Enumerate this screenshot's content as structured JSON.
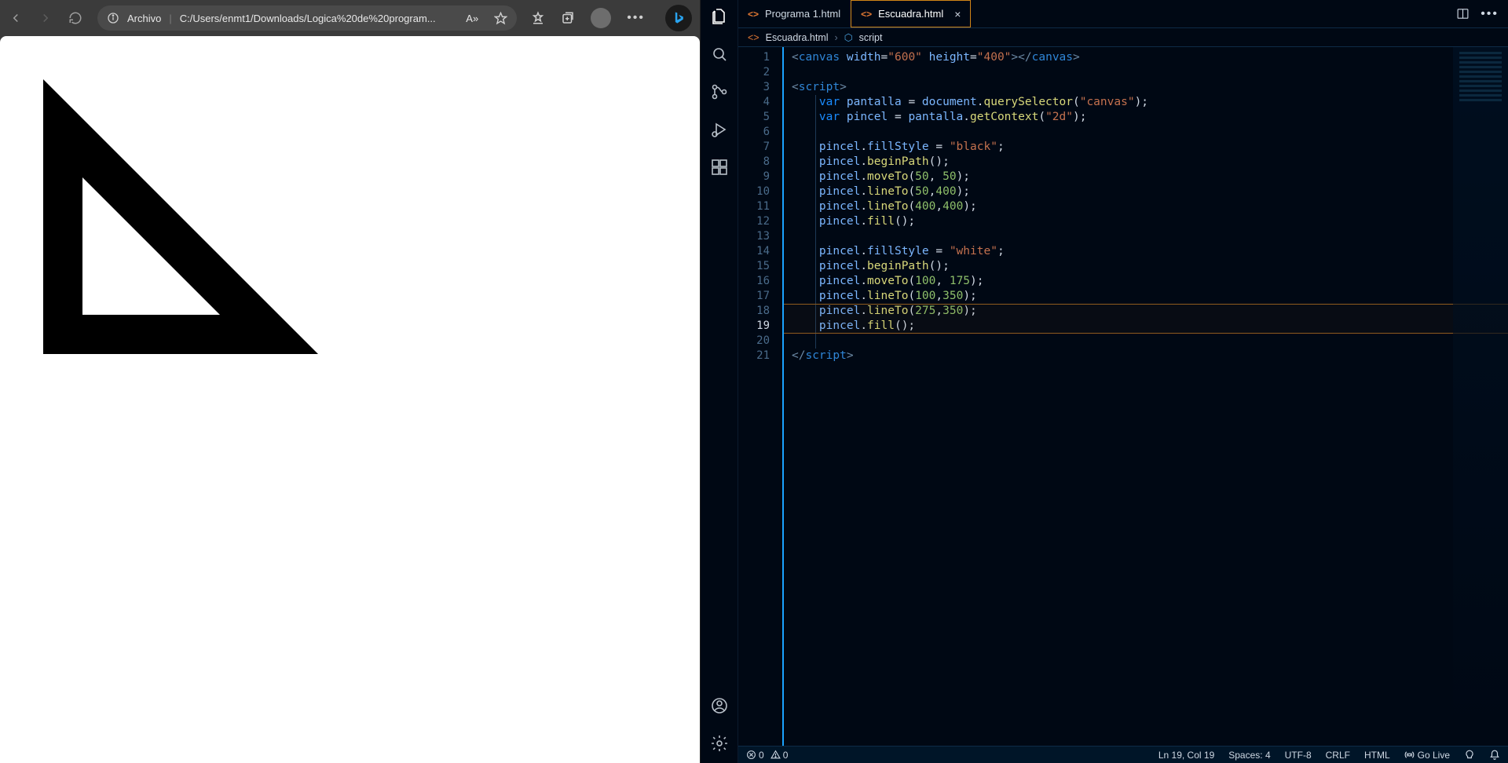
{
  "browser": {
    "archivo_label": "Archivo",
    "url": "C:/Users/enmt1/Downloads/Logica%20de%20program...",
    "favorites_badge": "A»"
  },
  "vscode": {
    "tabs": [
      {
        "icon": "<>",
        "label": "Programa 1.html",
        "active": false
      },
      {
        "icon": "<>",
        "label": "Escuadra.html",
        "active": true
      }
    ],
    "breadcrumb": {
      "file_icon": "<>",
      "file": "Escuadra.html",
      "segment_icon": "⬡",
      "segment": "script"
    },
    "gutter": [
      "1",
      "2",
      "3",
      "4",
      "5",
      "6",
      "7",
      "8",
      "9",
      "10",
      "11",
      "12",
      "13",
      "14",
      "15",
      "16",
      "17",
      "18",
      "19",
      "20",
      "21"
    ],
    "current_line": "19",
    "status": {
      "errors": "0",
      "warnings": "0",
      "position": "Ln 19, Col 19",
      "spaces": "Spaces: 4",
      "encoding": "UTF-8",
      "eol": "CRLF",
      "lang": "HTML",
      "golive": "Go Live"
    },
    "code_tokens": [
      [
        {
          "c": "tk-pun",
          "t": "<"
        },
        {
          "c": "tk-tag",
          "t": "canvas"
        },
        {
          "c": "",
          "t": " "
        },
        {
          "c": "tk-attr",
          "t": "width"
        },
        {
          "c": "tk-op",
          "t": "="
        },
        {
          "c": "tk-str",
          "t": "\"600\""
        },
        {
          "c": "",
          "t": " "
        },
        {
          "c": "tk-attr",
          "t": "height"
        },
        {
          "c": "tk-op",
          "t": "="
        },
        {
          "c": "tk-str",
          "t": "\"400\""
        },
        {
          "c": "tk-pun",
          "t": "></"
        },
        {
          "c": "tk-tag",
          "t": "canvas"
        },
        {
          "c": "tk-pun",
          "t": ">"
        }
      ],
      [],
      [
        {
          "c": "tk-pun",
          "t": "<"
        },
        {
          "c": "tk-tag",
          "t": "script"
        },
        {
          "c": "tk-pun",
          "t": ">"
        }
      ],
      [
        {
          "c": "",
          "t": "    "
        },
        {
          "c": "tk-kw",
          "t": "var"
        },
        {
          "c": "",
          "t": " "
        },
        {
          "c": "tk-var",
          "t": "pantalla"
        },
        {
          "c": "",
          "t": " "
        },
        {
          "c": "tk-op",
          "t": "="
        },
        {
          "c": "",
          "t": " "
        },
        {
          "c": "tk-var",
          "t": "document"
        },
        {
          "c": "tk-op",
          "t": "."
        },
        {
          "c": "tk-fn",
          "t": "querySelector"
        },
        {
          "c": "tk-op",
          "t": "("
        },
        {
          "c": "tk-str",
          "t": "\"canvas\""
        },
        {
          "c": "tk-op",
          "t": ");"
        }
      ],
      [
        {
          "c": "",
          "t": "    "
        },
        {
          "c": "tk-kw",
          "t": "var"
        },
        {
          "c": "",
          "t": " "
        },
        {
          "c": "tk-var",
          "t": "pincel"
        },
        {
          "c": "",
          "t": " "
        },
        {
          "c": "tk-op",
          "t": "="
        },
        {
          "c": "",
          "t": " "
        },
        {
          "c": "tk-var",
          "t": "pantalla"
        },
        {
          "c": "tk-op",
          "t": "."
        },
        {
          "c": "tk-fn",
          "t": "getContext"
        },
        {
          "c": "tk-op",
          "t": "("
        },
        {
          "c": "tk-str",
          "t": "\"2d\""
        },
        {
          "c": "tk-op",
          "t": ");"
        }
      ],
      [],
      [
        {
          "c": "",
          "t": "    "
        },
        {
          "c": "tk-var",
          "t": "pincel"
        },
        {
          "c": "tk-op",
          "t": "."
        },
        {
          "c": "tk-prop",
          "t": "fillStyle"
        },
        {
          "c": "",
          "t": " "
        },
        {
          "c": "tk-op",
          "t": "="
        },
        {
          "c": "",
          "t": " "
        },
        {
          "c": "tk-str",
          "t": "\"black\""
        },
        {
          "c": "tk-op",
          "t": ";"
        }
      ],
      [
        {
          "c": "",
          "t": "    "
        },
        {
          "c": "tk-var",
          "t": "pincel"
        },
        {
          "c": "tk-op",
          "t": "."
        },
        {
          "c": "tk-fn",
          "t": "beginPath"
        },
        {
          "c": "tk-op",
          "t": "();"
        }
      ],
      [
        {
          "c": "",
          "t": "    "
        },
        {
          "c": "tk-var",
          "t": "pincel"
        },
        {
          "c": "tk-op",
          "t": "."
        },
        {
          "c": "tk-fn",
          "t": "moveTo"
        },
        {
          "c": "tk-op",
          "t": "("
        },
        {
          "c": "tk-num",
          "t": "50"
        },
        {
          "c": "tk-op",
          "t": ", "
        },
        {
          "c": "tk-num",
          "t": "50"
        },
        {
          "c": "tk-op",
          "t": ");"
        }
      ],
      [
        {
          "c": "",
          "t": "    "
        },
        {
          "c": "tk-var",
          "t": "pincel"
        },
        {
          "c": "tk-op",
          "t": "."
        },
        {
          "c": "tk-fn",
          "t": "lineTo"
        },
        {
          "c": "tk-op",
          "t": "("
        },
        {
          "c": "tk-num",
          "t": "50"
        },
        {
          "c": "tk-op",
          "t": ","
        },
        {
          "c": "tk-num",
          "t": "400"
        },
        {
          "c": "tk-op",
          "t": ");"
        }
      ],
      [
        {
          "c": "",
          "t": "    "
        },
        {
          "c": "tk-var",
          "t": "pincel"
        },
        {
          "c": "tk-op",
          "t": "."
        },
        {
          "c": "tk-fn",
          "t": "lineTo"
        },
        {
          "c": "tk-op",
          "t": "("
        },
        {
          "c": "tk-num",
          "t": "400"
        },
        {
          "c": "tk-op",
          "t": ","
        },
        {
          "c": "tk-num",
          "t": "400"
        },
        {
          "c": "tk-op",
          "t": ");"
        }
      ],
      [
        {
          "c": "",
          "t": "    "
        },
        {
          "c": "tk-var",
          "t": "pincel"
        },
        {
          "c": "tk-op",
          "t": "."
        },
        {
          "c": "tk-fn",
          "t": "fill"
        },
        {
          "c": "tk-op",
          "t": "();"
        }
      ],
      [],
      [
        {
          "c": "",
          "t": "    "
        },
        {
          "c": "tk-var",
          "t": "pincel"
        },
        {
          "c": "tk-op",
          "t": "."
        },
        {
          "c": "tk-prop",
          "t": "fillStyle"
        },
        {
          "c": "",
          "t": " "
        },
        {
          "c": "tk-op",
          "t": "="
        },
        {
          "c": "",
          "t": " "
        },
        {
          "c": "tk-str",
          "t": "\"white\""
        },
        {
          "c": "tk-op",
          "t": ";"
        }
      ],
      [
        {
          "c": "",
          "t": "    "
        },
        {
          "c": "tk-var",
          "t": "pincel"
        },
        {
          "c": "tk-op",
          "t": "."
        },
        {
          "c": "tk-fn",
          "t": "beginPath"
        },
        {
          "c": "tk-op",
          "t": "();"
        }
      ],
      [
        {
          "c": "",
          "t": "    "
        },
        {
          "c": "tk-var",
          "t": "pincel"
        },
        {
          "c": "tk-op",
          "t": "."
        },
        {
          "c": "tk-fn",
          "t": "moveTo"
        },
        {
          "c": "tk-op",
          "t": "("
        },
        {
          "c": "tk-num",
          "t": "100"
        },
        {
          "c": "tk-op",
          "t": ", "
        },
        {
          "c": "tk-num",
          "t": "175"
        },
        {
          "c": "tk-op",
          "t": ");"
        }
      ],
      [
        {
          "c": "",
          "t": "    "
        },
        {
          "c": "tk-var",
          "t": "pincel"
        },
        {
          "c": "tk-op",
          "t": "."
        },
        {
          "c": "tk-fn",
          "t": "lineTo"
        },
        {
          "c": "tk-op",
          "t": "("
        },
        {
          "c": "tk-num",
          "t": "100"
        },
        {
          "c": "tk-op",
          "t": ","
        },
        {
          "c": "tk-num",
          "t": "350"
        },
        {
          "c": "tk-op",
          "t": ");"
        }
      ],
      [
        {
          "c": "",
          "t": "    "
        },
        {
          "c": "tk-var",
          "t": "pincel"
        },
        {
          "c": "tk-op",
          "t": "."
        },
        {
          "c": "tk-fn",
          "t": "lineTo"
        },
        {
          "c": "tk-op",
          "t": "("
        },
        {
          "c": "tk-num",
          "t": "275"
        },
        {
          "c": "tk-op",
          "t": ","
        },
        {
          "c": "tk-num",
          "t": "350"
        },
        {
          "c": "tk-op",
          "t": ");"
        }
      ],
      [
        {
          "c": "",
          "t": "    "
        },
        {
          "c": "tk-var",
          "t": "pincel"
        },
        {
          "c": "tk-op",
          "t": "."
        },
        {
          "c": "tk-fn",
          "t": "fill"
        },
        {
          "c": "tk-op",
          "t": "();"
        }
      ],
      [],
      [
        {
          "c": "tk-pun",
          "t": "</"
        },
        {
          "c": "tk-tag",
          "t": "script"
        },
        {
          "c": "tk-pun",
          "t": ">"
        }
      ]
    ]
  }
}
